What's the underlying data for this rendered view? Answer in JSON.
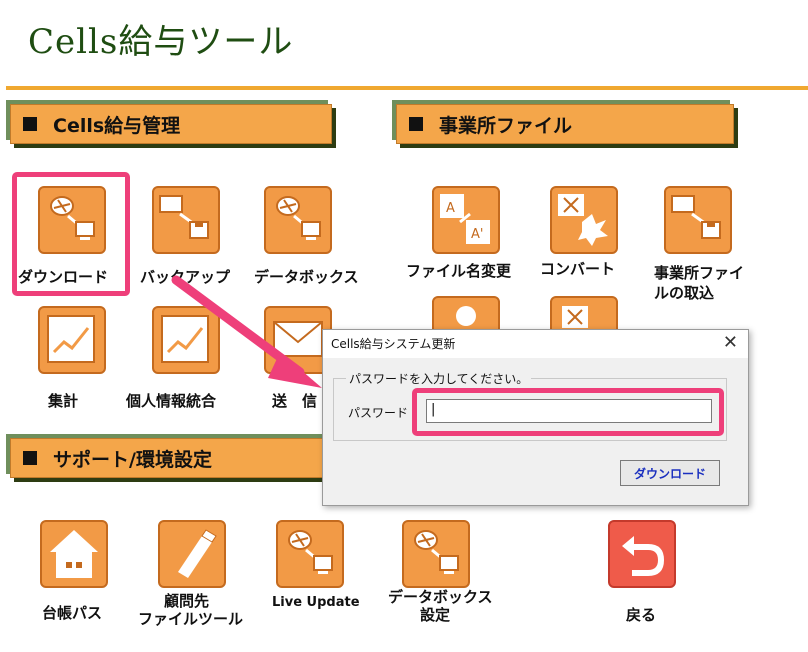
{
  "app_title": "Cells給与ツール",
  "sections": {
    "kyuyo": "Cells給与管理",
    "jigyosho": "事業所ファイル",
    "support": "サポート/環境設定"
  },
  "tiles": {
    "download": "ダウンロード",
    "backup": "バックアップ",
    "databox": "データボックス",
    "shukei": "集計",
    "kojin": "個人情報統合",
    "soshin": "送　信",
    "rename": "ファイル名変更",
    "convert": "コンバート",
    "torikomi_1": "事業所ファイ",
    "torikomi_2": "ルの取込",
    "daicho": "台帳パス",
    "komon_1": "顧問先",
    "komon_2": "ファイルツール",
    "liveupdate": "Live Update",
    "databox_settei_1": "データボックス",
    "databox_settei_2": "設定",
    "modoru": "戻る"
  },
  "dialog": {
    "title": "Cells給与システム更新",
    "close": "✕",
    "group_label": "パスワードを入力してください。",
    "password_label": "パスワード",
    "password_value": "|",
    "download_button": "ダウンロード"
  },
  "colors": {
    "tile_orange": "#f29a46",
    "highlight_pink": "#ee3f7a",
    "title_green": "#1f4d12",
    "rule_orange": "#f0a830"
  }
}
